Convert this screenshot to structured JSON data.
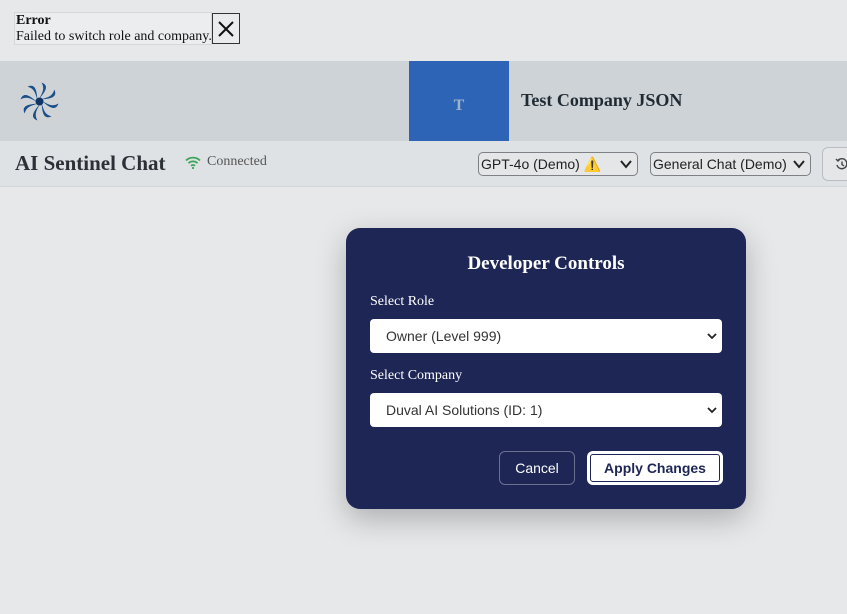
{
  "error": {
    "title": "Error",
    "message": "Failed to switch role and company."
  },
  "header": {
    "company_initial": "T",
    "company_name": "Test Company JSON"
  },
  "chat_header": {
    "title": "AI Sentinel Chat",
    "status": "Connected",
    "model": "GPT-4o (Demo) ⚠️",
    "chat_type": "General Chat (Demo)"
  },
  "modal": {
    "title": "Developer Controls",
    "role_label": "Select Role",
    "role_value": "Owner (Level 999)",
    "company_label": "Select Company",
    "company_value": "Duval AI Solutions (ID: 1)",
    "cancel_label": "Cancel",
    "apply_label": "Apply Changes"
  },
  "colors": {
    "modal_bg": "#1e2655",
    "company_tile": "#2e64b5",
    "connected": "#3aa55a"
  }
}
